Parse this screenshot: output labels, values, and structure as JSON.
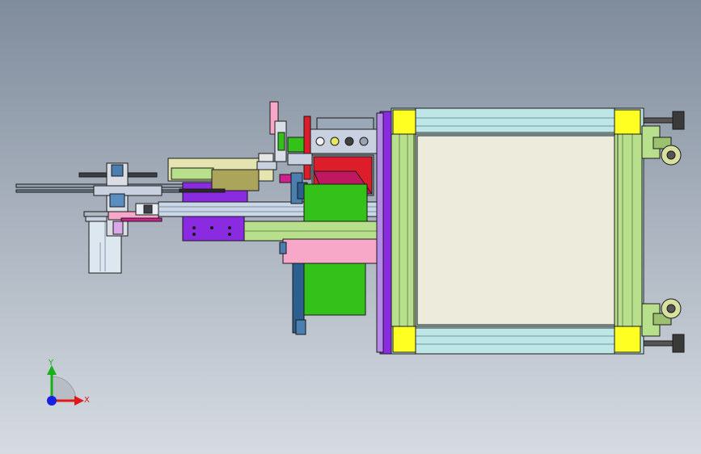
{
  "viewport": {
    "background_top": "#7f8c9c",
    "background_bottom": "#d6dbe2"
  },
  "triad": {
    "x_label": "X",
    "y_label": "Y",
    "x_color": "#e01818",
    "y_color": "#18b018",
    "z_color": "#1820e0"
  },
  "colors": {
    "outline": "#1a1a1a",
    "frame_cyan": "#bfe6e6",
    "frame_green": "#b8df8c",
    "corner_yellow": "#ffff22",
    "panel_cream": "#ecebdc",
    "purple": "#8a2be2",
    "pink": "#f7a8c8",
    "green_block": "#33c11a",
    "olive": "#aaa55a",
    "steel_blue": "#4a7fb0",
    "grey_blue": "#c9d1e0",
    "magenta": "#d02090",
    "red": "#dd1e2a",
    "white_body": "#dde7f0"
  }
}
